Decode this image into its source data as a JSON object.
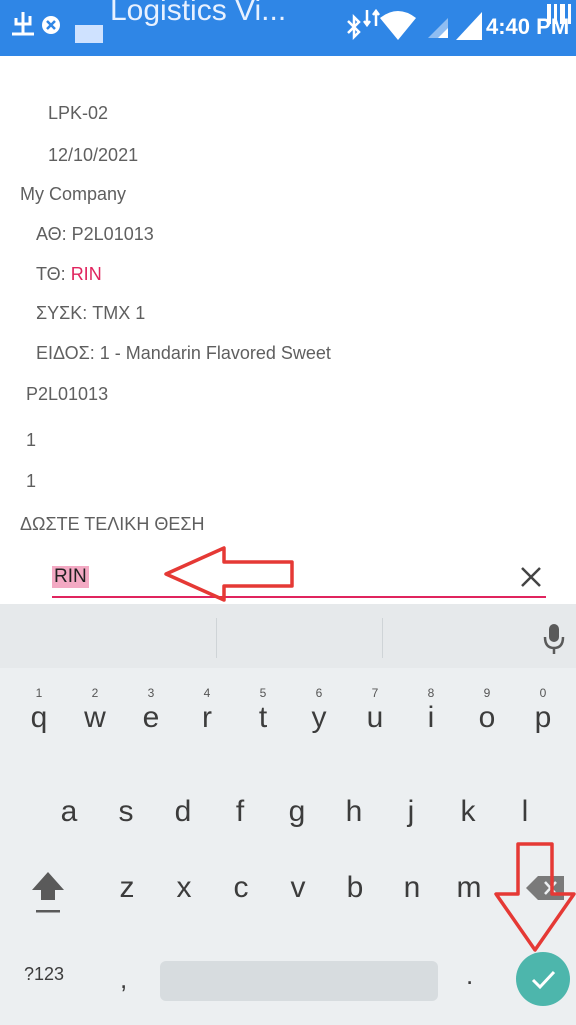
{
  "status_bar": {
    "app_title": "Logistics Vi...",
    "time": "4:40 PM",
    "icons": [
      "usb-icon",
      "notification-icon",
      "bluetooth-icon",
      "wifi-icon",
      "signal-icon",
      "battery-icon"
    ]
  },
  "details": {
    "code": "LPK-02",
    "date": "12/10/2021",
    "company": "My Company",
    "ath_label": "ΑΘ:",
    "ath_value": "P2L01013",
    "tth_label": "ΤΘ:",
    "tth_value": "RIN",
    "sysk_label": "ΣΥΣΚ:",
    "sysk_value": "TMX 1",
    "eidos_label": "ΕΙΔΟΣ:",
    "eidos_value": "1 - Mandarin Flavored Sweet",
    "location_code": "P2L01013",
    "qty_1": "1",
    "qty_2": "1",
    "prompt": "ΔΩΣΤΕ ΤΕΛΙΚΗ ΘΕΣΗ"
  },
  "input": {
    "value": "RIN"
  },
  "keyboard": {
    "row1": [
      {
        "key": "q",
        "hint": "1"
      },
      {
        "key": "w",
        "hint": "2"
      },
      {
        "key": "e",
        "hint": "3"
      },
      {
        "key": "r",
        "hint": "4"
      },
      {
        "key": "t",
        "hint": "5"
      },
      {
        "key": "y",
        "hint": "6"
      },
      {
        "key": "u",
        "hint": "7"
      },
      {
        "key": "i",
        "hint": "8"
      },
      {
        "key": "o",
        "hint": "9"
      },
      {
        "key": "p",
        "hint": "0"
      }
    ],
    "row2": [
      "a",
      "s",
      "d",
      "f",
      "g",
      "h",
      "j",
      "k",
      "l"
    ],
    "row3": [
      "z",
      "x",
      "c",
      "v",
      "b",
      "n",
      "m"
    ],
    "symbols_label": "?123",
    "comma_label": ",",
    "period_label": "."
  },
  "colors": {
    "status_bar": "#2f86e6",
    "accent_pink": "#e0245e",
    "enter_key": "#4db6ac",
    "annotation_red": "#e53935"
  }
}
